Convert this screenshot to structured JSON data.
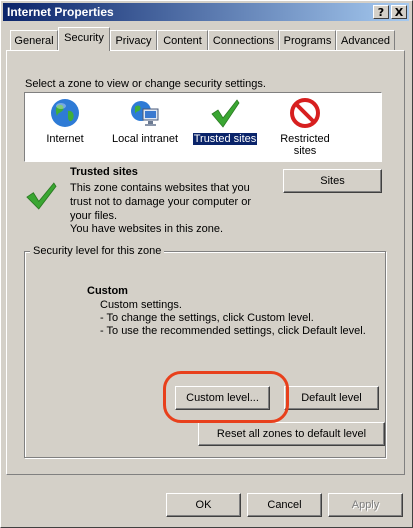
{
  "window": {
    "title": "Internet Properties",
    "help_btn": "?",
    "close_btn": "X"
  },
  "tabs": [
    {
      "label": "General"
    },
    {
      "label": "Security"
    },
    {
      "label": "Privacy"
    },
    {
      "label": "Content"
    },
    {
      "label": "Connections"
    },
    {
      "label": "Programs"
    },
    {
      "label": "Advanced"
    }
  ],
  "security": {
    "select_zone_label": "Select a zone to view or change security settings.",
    "zones": [
      {
        "label1": "Internet",
        "label2": "",
        "icon": "globe-icon"
      },
      {
        "label1": "Local intranet",
        "label2": "",
        "icon": "intranet-icon"
      },
      {
        "label1": "Trusted sites",
        "label2": "",
        "icon": "checkmark-icon"
      },
      {
        "label1": "Restricted",
        "label2": "sites",
        "icon": "restricted-icon"
      }
    ],
    "selected_zone": {
      "title": "Trusted sites",
      "desc_lines": [
        "This zone contains websites that you",
        "trust not to damage your computer or",
        "your files.",
        "You have websites in this zone."
      ]
    },
    "sites_button": "Sites",
    "level_group_title": "Security level for this zone",
    "level": {
      "title": "Custom",
      "lines": [
        "Custom settings.",
        "- To change the settings, click Custom level.",
        "- To use the recommended settings, click Default level."
      ]
    },
    "custom_level_button": "Custom level...",
    "default_level_button": "Default level",
    "reset_button": "Reset all zones to default level"
  },
  "footer": {
    "ok": "OK",
    "cancel": "Cancel",
    "apply": "Apply"
  },
  "colors": {
    "highlight": "#e8401c",
    "titlebar": "#0a246a",
    "check": "#3aa632"
  }
}
